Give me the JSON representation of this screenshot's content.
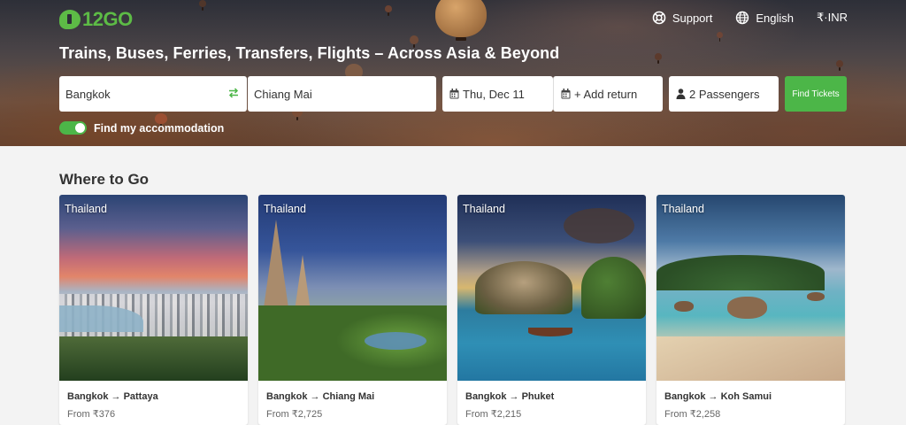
{
  "brand": {
    "name": "12GO",
    "color": "#5dbb46"
  },
  "nav": {
    "support": "Support",
    "language": "English",
    "currency": "₹·INR"
  },
  "hero": {
    "title": "Trains, Buses, Ferries, Transfers, Flights – Across Asia & Beyond"
  },
  "search": {
    "from": "Bangkok",
    "to": "Chiang Mai",
    "date": "Thu, Dec 11",
    "return": "+ Add return",
    "passengers": "2 Passengers",
    "submit": "Find Tickets"
  },
  "accommodation": {
    "label": "Find my accommodation",
    "enabled": true
  },
  "where_to_go": {
    "title": "Where to Go",
    "cards": [
      {
        "country": "Thailand",
        "route": "Bangkok → Pattaya",
        "price": "From ₹376"
      },
      {
        "country": "Thailand",
        "route": "Bangkok → Chiang Mai",
        "price": "From ₹2,725"
      },
      {
        "country": "Thailand",
        "route": "Bangkok → Phuket",
        "price": "From ₹2,215"
      },
      {
        "country": "Thailand",
        "route": "Bangkok → Koh Samui",
        "price": "From ₹2,258"
      }
    ]
  },
  "colors": {
    "accent": "#4cb648"
  },
  "icons": [
    "support-icon",
    "globe-icon",
    "swap-icon",
    "calendar-icon",
    "person-icon"
  ]
}
